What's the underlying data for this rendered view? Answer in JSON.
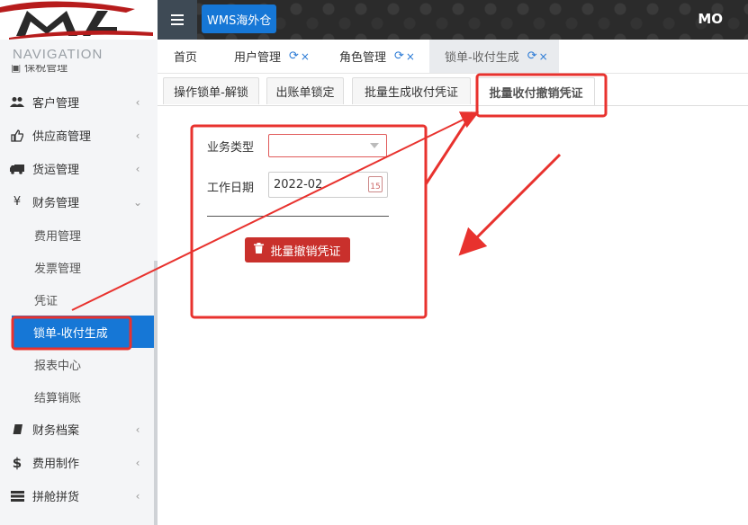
{
  "header": {
    "app_button": "WMS海外仓",
    "user": "MO"
  },
  "sidebar": {
    "nav_title": "NAVIGATION",
    "cut_item": "保税管理",
    "items": [
      {
        "label": "客户管理",
        "icon": "users-icon"
      },
      {
        "label": "供应商管理",
        "icon": "thumbs-up-icon"
      },
      {
        "label": "货运管理",
        "icon": "truck-icon"
      },
      {
        "label": "财务管理",
        "icon": "yen-icon",
        "expanded": true
      },
      {
        "label": "财务档案",
        "icon": "book-icon"
      },
      {
        "label": "费用制作",
        "icon": "dollar-icon"
      },
      {
        "label": "拼舱拼货",
        "icon": "server-icon"
      }
    ],
    "sub_items": [
      {
        "label": "费用管理"
      },
      {
        "label": "发票管理"
      },
      {
        "label": "凭证"
      },
      {
        "label": "锁单-收付生成",
        "active": true
      },
      {
        "label": "报表中心"
      },
      {
        "label": "结算销账"
      }
    ],
    "yen_symbol": "¥",
    "dollar_symbol": "$"
  },
  "tabs": [
    {
      "label": "首页"
    },
    {
      "label": "用户管理"
    },
    {
      "label": "角色管理"
    },
    {
      "label": "锁单-收付生成",
      "active": true
    }
  ],
  "subtabs": [
    {
      "label": "操作锁单-解锁"
    },
    {
      "label": "出账单锁定"
    },
    {
      "label": "批量生成收付凭证"
    },
    {
      "label": "批量收付撤销凭证",
      "active": true
    }
  ],
  "form": {
    "business_type_label": "业务类型",
    "business_type_value": "",
    "work_date_label": "工作日期",
    "work_date_value": "2022-02",
    "calendar_day": "15",
    "submit_label": "批量撤销凭证"
  },
  "colors": {
    "accent": "#1677d6",
    "danger": "#c9302c",
    "annotation": "#e8322e"
  }
}
